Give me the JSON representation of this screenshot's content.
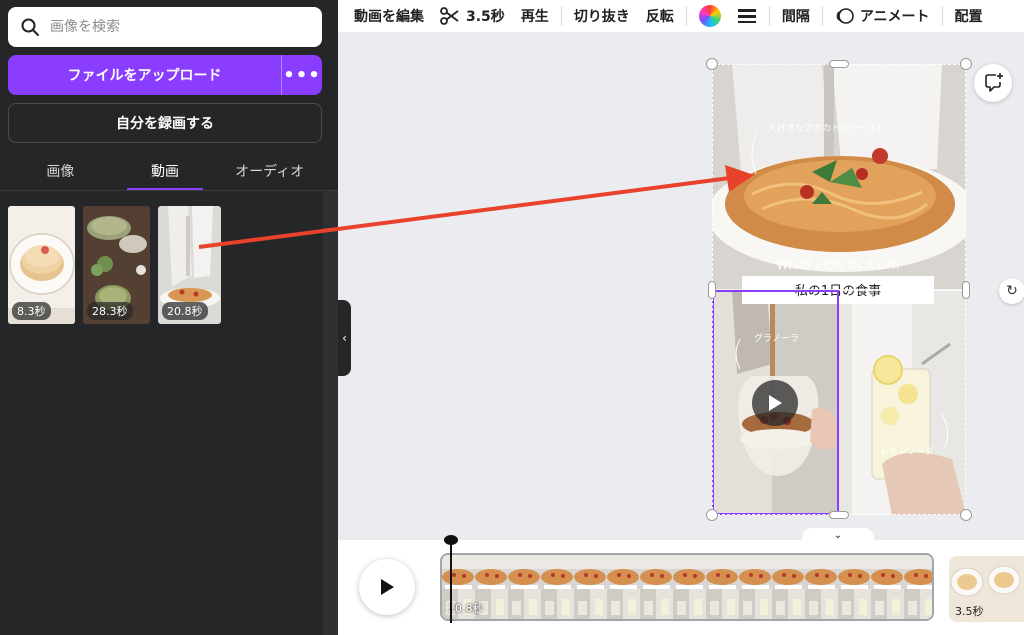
{
  "search": {
    "placeholder": "画像を検索"
  },
  "upload": {
    "label": "ファイルをアップロード",
    "more_label": "•••"
  },
  "record": {
    "label": "自分を録画する"
  },
  "tabs": [
    {
      "label": "画像"
    },
    {
      "label": "動画"
    },
    {
      "label": "オーディオ"
    }
  ],
  "thumbnails": [
    {
      "duration": "8.3秒"
    },
    {
      "duration": "28.3秒"
    },
    {
      "duration": "20.8秒"
    }
  ],
  "toolbar": {
    "edit_video": "動画を編集",
    "split_duration": "3.5秒",
    "play": "再生",
    "trim": "切り抜き",
    "flip": "反転",
    "spacing": "間隔",
    "animate": "アニメート",
    "position": "配置"
  },
  "design": {
    "caption_top": "大好きなアボカド卵トースト",
    "banner_en": "WHAT I EAT IN A DAY",
    "banner_jp": "私の1日の食事",
    "caption_left": "グラノーラ",
    "caption_right": "レモンソーダ"
  },
  "timeline": {
    "clip_duration": "20.8秒",
    "next_clip_duration": "3.5秒"
  },
  "colors": {
    "accent": "#8b3dff",
    "annotation_arrow": "#e8412c"
  }
}
